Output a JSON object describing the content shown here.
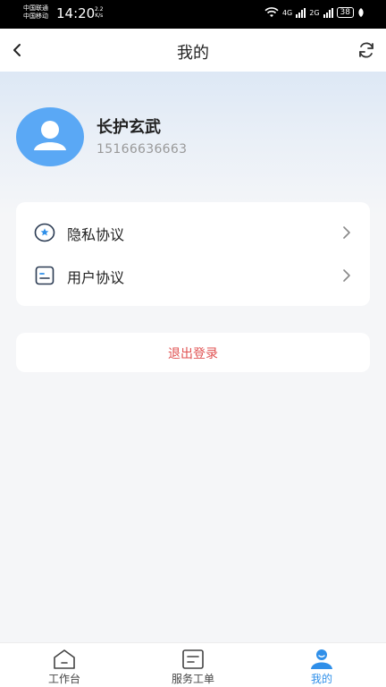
{
  "statusbar": {
    "carrier1": "中国联通",
    "carrier2": "中国移动",
    "time": "14:20",
    "speed_value": "2.2",
    "speed_unit": "K/s",
    "net1": "4G",
    "net2": "2G",
    "battery": "38"
  },
  "navbar": {
    "title": "我的"
  },
  "profile": {
    "name": "长护玄武",
    "phone": "15166636663"
  },
  "menu": {
    "items": [
      {
        "label": "隐私协议",
        "icon": "shield-star-icon"
      },
      {
        "label": "用户协议",
        "icon": "document-icon"
      }
    ]
  },
  "logout": {
    "label": "退出登录",
    "color": "#e05252"
  },
  "tabbar": {
    "tabs": [
      {
        "label": "工作台",
        "icon": "home-icon"
      },
      {
        "label": "服务工单",
        "icon": "work-order-icon"
      },
      {
        "label": "我的",
        "icon": "user-icon",
        "active": true
      }
    ],
    "active_color": "#2f8fe9"
  },
  "colors": {
    "avatar_blue": "#5aa8f5",
    "accent": "#2f8fe9"
  }
}
